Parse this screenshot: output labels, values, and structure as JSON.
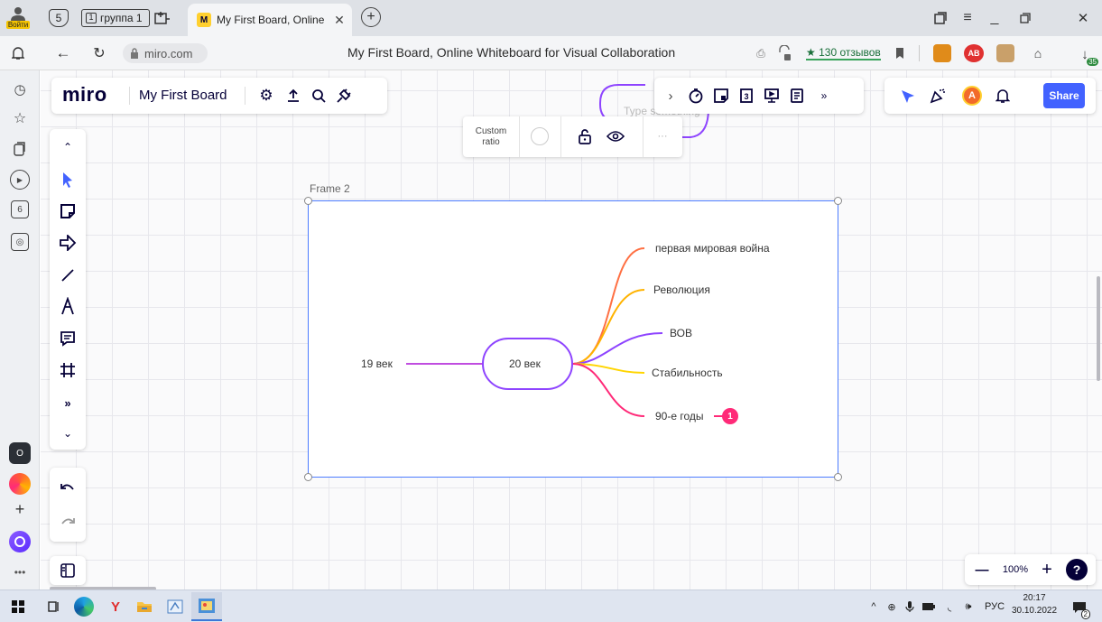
{
  "browser": {
    "login_label": "Войти",
    "tab_counter": "5",
    "tab_group_label": "группа 1",
    "active_tab_title": "My First Board, Online W",
    "url": "miro.com",
    "page_title": "My First Board, Online Whiteboard for Visual Collaboration",
    "reviews_label": "★ 130 отзывов",
    "download_badge": "35",
    "sidebar_badge": "6"
  },
  "miro": {
    "logo": "miro",
    "board_name": "My First Board",
    "share_label": "Share",
    "avatar_initial": "A",
    "context_toolbar": {
      "ratio_label_line1": "Custom",
      "ratio_label_line2": "ratio",
      "more_label": "···"
    },
    "hidden_text": "Type something",
    "zoom": {
      "minus": "—",
      "value": "100%",
      "plus": "+",
      "help": "?"
    },
    "frame": {
      "title": "Frame 2"
    },
    "mindmap": {
      "center": "20 век",
      "left_node": "19 век",
      "branches": [
        {
          "label": "первая мировая война",
          "color": "#ff7043"
        },
        {
          "label": "Революция",
          "color": "#ffb300"
        },
        {
          "label": "ВОВ",
          "color": "#8e44ff"
        },
        {
          "label": "Стабильность",
          "color": "#ffd500"
        },
        {
          "label": "90-е годы",
          "color": "#ff2a78"
        }
      ],
      "comment_count": "1"
    }
  },
  "taskbar": {
    "lang": "РУС",
    "time": "20:17",
    "date": "30.10.2022",
    "notification_count": "2"
  },
  "colors": {
    "accent": "#4262ff",
    "frame_border": "#4d7cff",
    "center_node": "#8e44ff"
  }
}
